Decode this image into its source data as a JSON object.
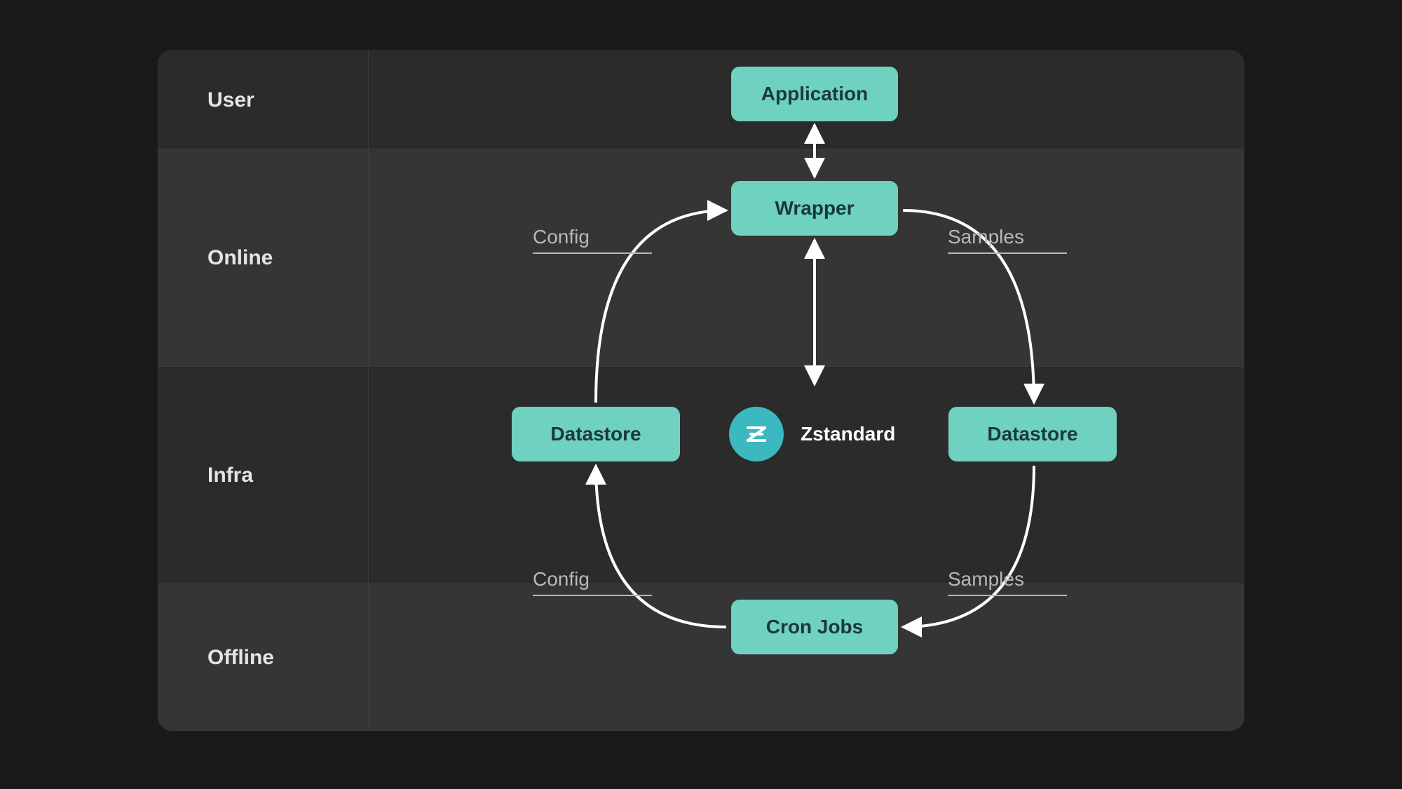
{
  "rows": {
    "user": "User",
    "online": "Online",
    "infra": "Infra",
    "offline": "Offline"
  },
  "nodes": {
    "application": "Application",
    "wrapper": "Wrapper",
    "datastore_left": "Datastore",
    "datastore_right": "Datastore",
    "cron": "Cron Jobs"
  },
  "center": {
    "label": "Zstandard"
  },
  "edges": {
    "config_top": "Config",
    "samples_top": "Samples",
    "config_bot": "Config",
    "samples_bot": "Samples"
  },
  "colors": {
    "node_bg": "#6fd1c0",
    "node_fg": "#1b3a36",
    "arrow": "#ffffff",
    "badge": "#3cb8c0"
  }
}
